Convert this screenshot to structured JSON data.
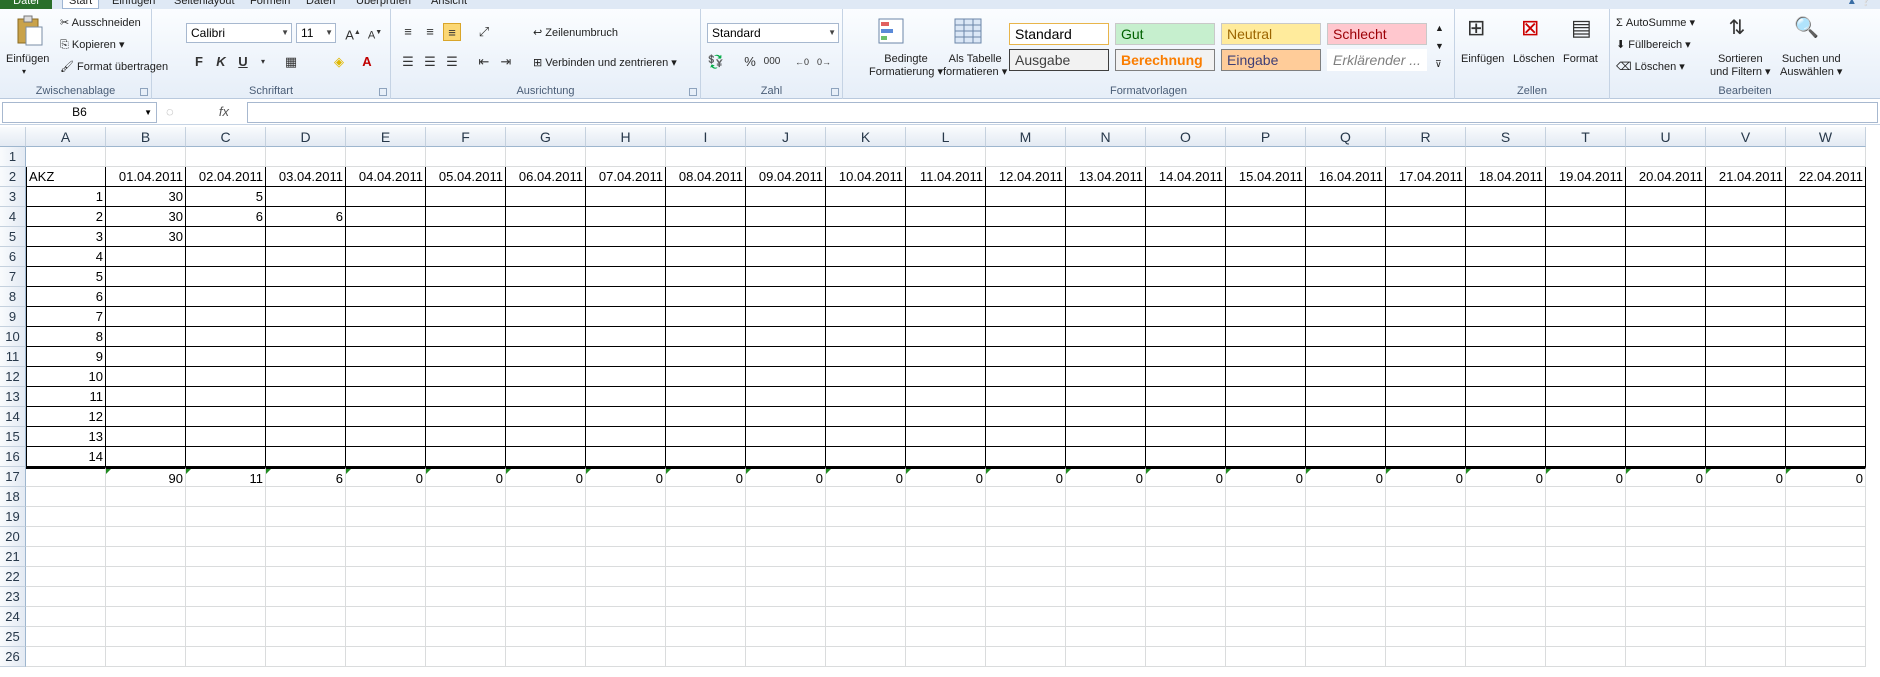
{
  "tabs": [
    {
      "label": "Datei"
    },
    {
      "label": "Start"
    },
    {
      "label": "Einfügen"
    },
    {
      "label": "Seitenlayout"
    },
    {
      "label": "Formeln"
    },
    {
      "label": "Daten"
    },
    {
      "label": "Überprüfen"
    },
    {
      "label": "Ansicht"
    }
  ],
  "ribbon": {
    "clipboard": {
      "label": "Zwischenablage",
      "paste": "Einfügen",
      "cut": "Ausschneiden",
      "copy": "Kopieren",
      "format_painter": "Format übertragen"
    },
    "font": {
      "label": "Schriftart",
      "name": "Calibri",
      "size": "11",
      "bold": "F",
      "italic": "K",
      "underline": "U"
    },
    "alignment": {
      "label": "Ausrichtung",
      "wrap": "Zeilenumbruch",
      "merge": "Verbinden und zentrieren"
    },
    "number": {
      "label": "Zahl",
      "format": "Standard",
      "percent": "%",
      "thousands": "000"
    },
    "styles": {
      "label": "Formatvorlagen",
      "cond": "Bedingte",
      "cond2": "Formatierung",
      "table": "Als Tabelle",
      "table2": "formatieren",
      "cells": [
        {
          "name": "Standard",
          "bg": "#ffffff",
          "fg": "#000000",
          "border": "#e8b54b"
        },
        {
          "name": "Gut",
          "bg": "#c6efce",
          "fg": "#006100",
          "border": "#c9c9c9"
        },
        {
          "name": "Neutral",
          "bg": "#ffeb9c",
          "fg": "#9c6500",
          "border": "#c9c9c9"
        },
        {
          "name": "Schlecht",
          "bg": "#ffc7ce",
          "fg": "#9c0006",
          "border": "#c9c9c9"
        },
        {
          "name": "Ausgabe",
          "bg": "#f2f2f2",
          "fg": "#3f3f3f",
          "border": "#3f3f3f"
        },
        {
          "name": "Berechnung",
          "bg": "#f2f2f2",
          "fg": "#fa7d00",
          "border": "#7f7f7f"
        },
        {
          "name": "Eingabe",
          "bg": "#ffcc99",
          "fg": "#3f3f76",
          "border": "#7f7f7f"
        },
        {
          "name": "Erklärender ...",
          "bg": "#ffffff",
          "fg": "#7f7f7f",
          "border": "#ffffff"
        }
      ]
    },
    "cells": {
      "label": "Zellen",
      "insert": "Einfügen",
      "delete": "Löschen",
      "format": "Format"
    },
    "edit": {
      "label": "Bearbeiten",
      "autosum": "AutoSumme",
      "fill": "Füllbereich",
      "clear": "Löschen",
      "sort": "Sortieren",
      "sort2": "und Filtern",
      "find": "Suchen und",
      "find2": "Auswählen"
    }
  },
  "formula_bar": {
    "name_box": "B6",
    "fx": "fx",
    "content": ""
  },
  "sheet": {
    "columns": [
      "A",
      "B",
      "C",
      "D",
      "E",
      "F",
      "G",
      "H",
      "I",
      "J",
      "K",
      "L",
      "M",
      "N",
      "O",
      "P",
      "Q",
      "R",
      "S",
      "T",
      "U",
      "V",
      "W"
    ],
    "row_numbers": [
      "1",
      "2",
      "3",
      "4",
      "5",
      "6",
      "7",
      "8",
      "9",
      "10",
      "11",
      "12",
      "13",
      "14",
      "15",
      "16",
      "17",
      "18",
      "19",
      "20",
      "21",
      "22",
      "23",
      "24",
      "25",
      "26"
    ],
    "header_label": "AKZ",
    "dates": [
      "01.04.2011",
      "02.04.2011",
      "03.04.2011",
      "04.04.2011",
      "05.04.2011",
      "06.04.2011",
      "07.04.2011",
      "08.04.2011",
      "09.04.2011",
      "10.04.2011",
      "11.04.2011",
      "12.04.2011",
      "13.04.2011",
      "14.04.2011",
      "15.04.2011",
      "16.04.2011",
      "17.04.2011",
      "18.04.2011",
      "19.04.2011",
      "20.04.2011",
      "21.04.2011",
      "22.04.2011"
    ],
    "akz": [
      "1",
      "2",
      "3",
      "4",
      "5",
      "6",
      "7",
      "8",
      "9",
      "10",
      "11",
      "12",
      "13",
      "14"
    ],
    "values": [
      [
        "30",
        "5",
        ""
      ],
      [
        "30",
        "6",
        "6"
      ],
      [
        "30",
        "",
        ""
      ]
    ],
    "totals": [
      "90",
      "11",
      "6",
      "0",
      "0",
      "0",
      "0",
      "0",
      "0",
      "0",
      "0",
      "0",
      "0",
      "0",
      "0",
      "0",
      "0",
      "0",
      "0",
      "0",
      "0",
      "0"
    ]
  }
}
